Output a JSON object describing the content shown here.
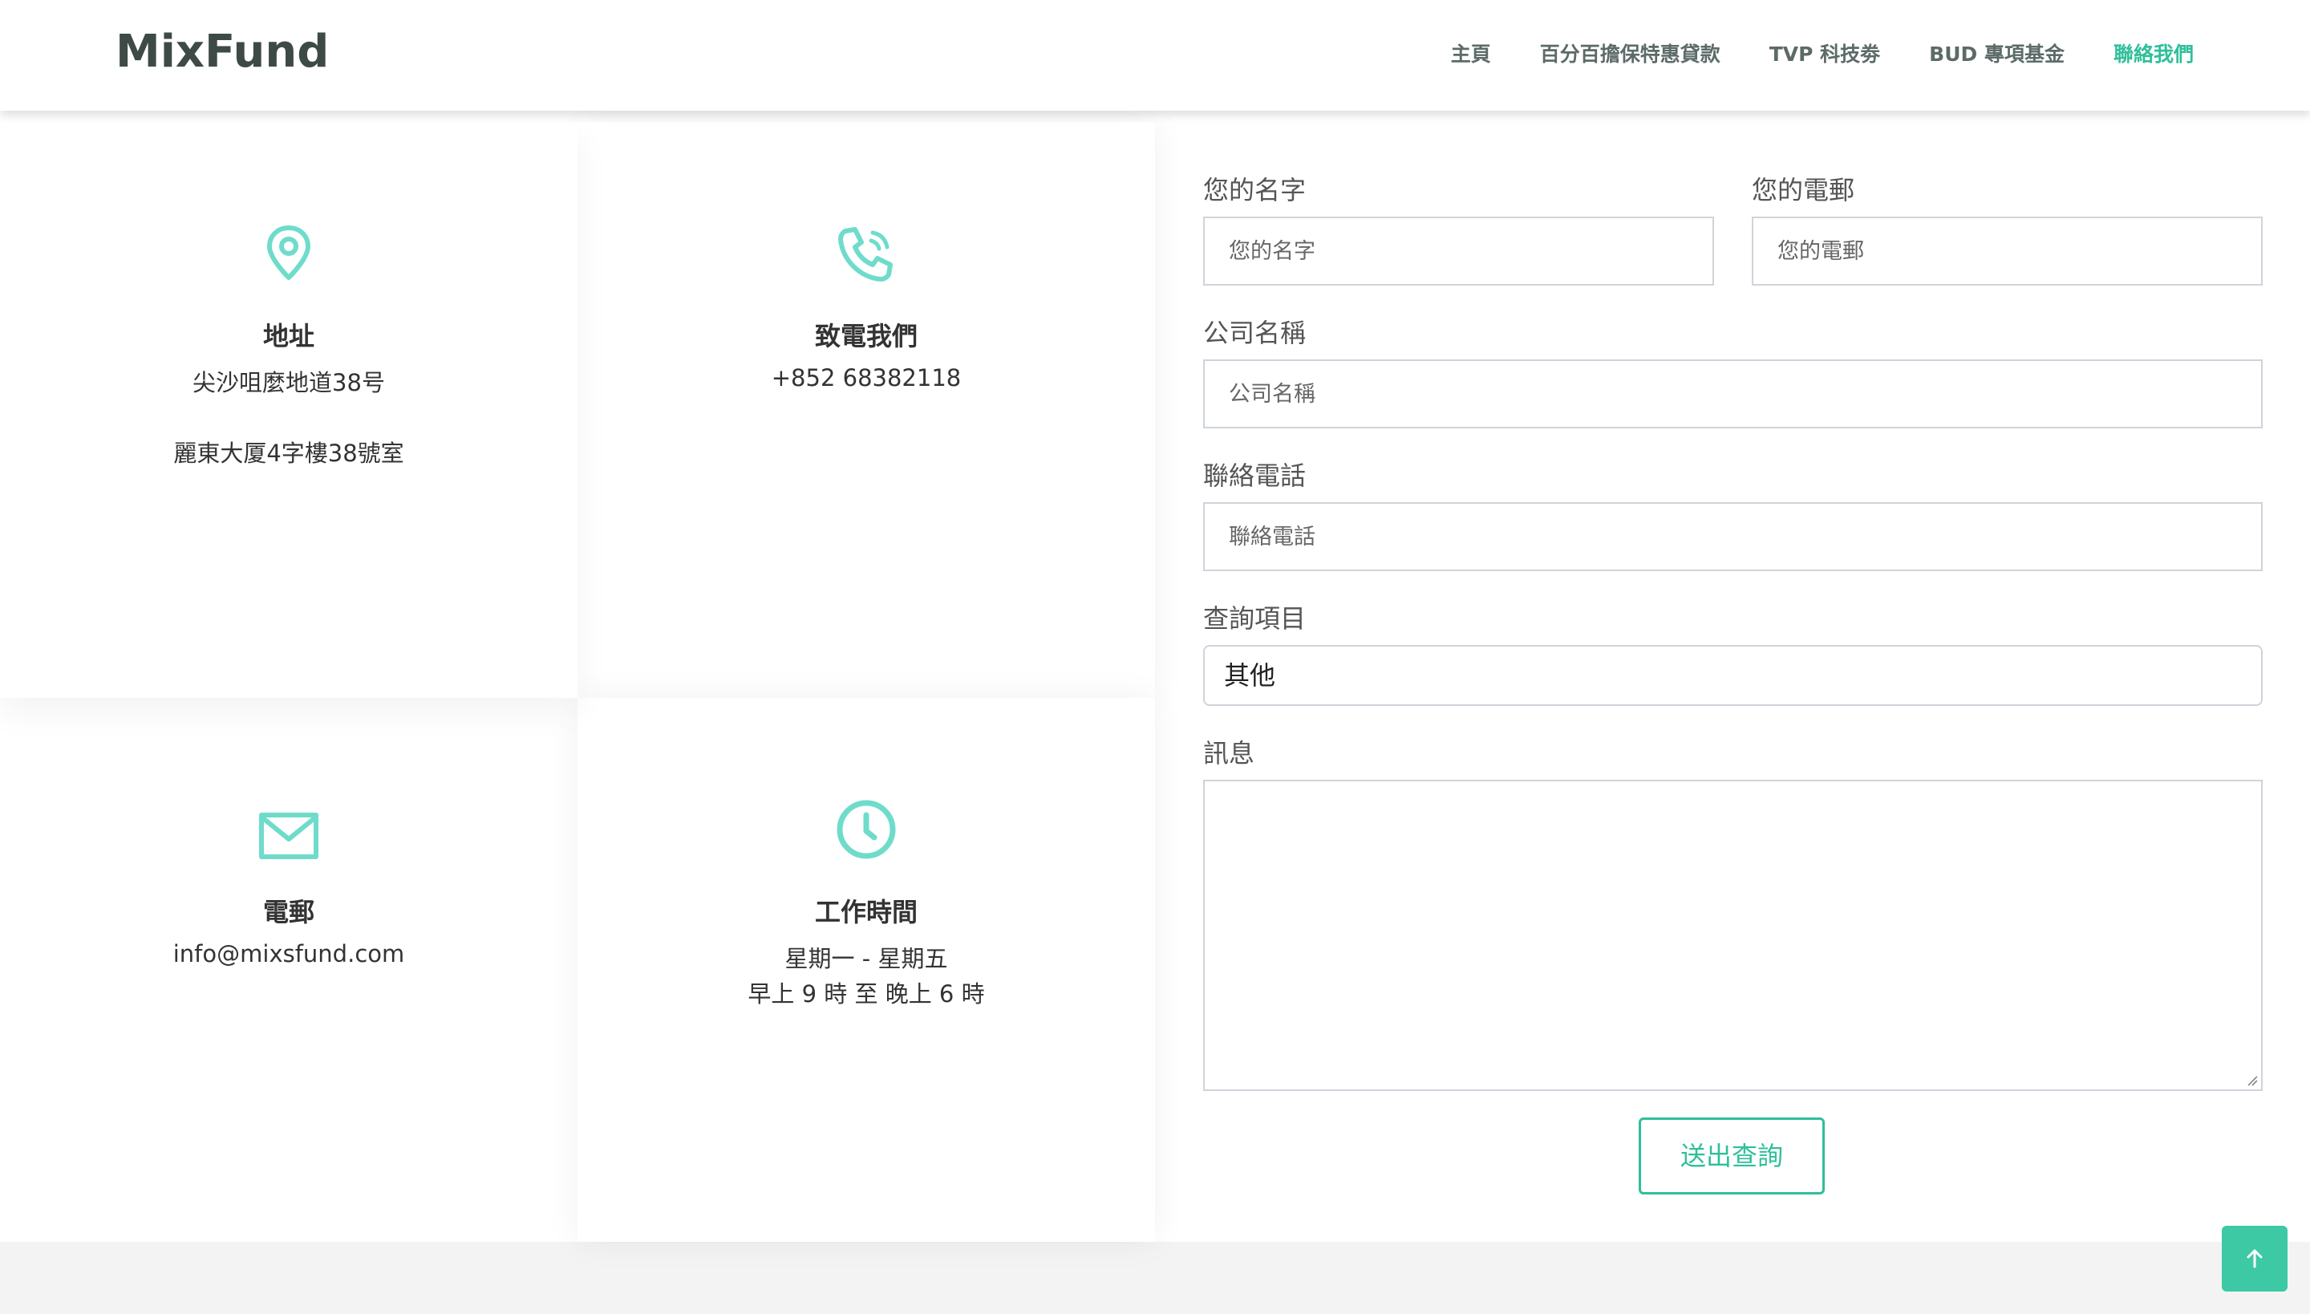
{
  "header": {
    "logo": "MixFund",
    "nav": [
      {
        "label": "主頁"
      },
      {
        "label": "百分百擔保特惠貸款"
      },
      {
        "label": "TVP 科技劵"
      },
      {
        "label": "BUD 專項基金"
      },
      {
        "label": "聯絡我們"
      }
    ]
  },
  "info": {
    "address": {
      "title": "地址",
      "line1": "尖沙咀麼地道38号",
      "line2": "麗東大厦4字樓38號室",
      "icon": "map-pin-icon"
    },
    "phone": {
      "title": "致電我們",
      "line1": "+852 68382118",
      "icon": "phone-icon"
    },
    "email": {
      "title": "電郵",
      "line1": "info@mixsfund.com",
      "icon": "mail-icon"
    },
    "hours": {
      "title": "工作時間",
      "line1": "星期一 - 星期五",
      "line2": "早上 9 時 至 晚上 6 時",
      "icon": "clock-icon"
    }
  },
  "form": {
    "name": {
      "label": "您的名字",
      "placeholder": "您的名字"
    },
    "email": {
      "label": "您的電郵",
      "placeholder": "您的電郵"
    },
    "company": {
      "label": "公司名稱",
      "placeholder": "公司名稱"
    },
    "phone": {
      "label": "聯絡電話",
      "placeholder": "聯絡電話"
    },
    "topic": {
      "label": "查詢項目",
      "value": "其他"
    },
    "message": {
      "label": "訊息"
    },
    "submit": "送出查詢"
  },
  "colors": {
    "accent": "#2fbf9a",
    "icon": "#6fdccb"
  }
}
